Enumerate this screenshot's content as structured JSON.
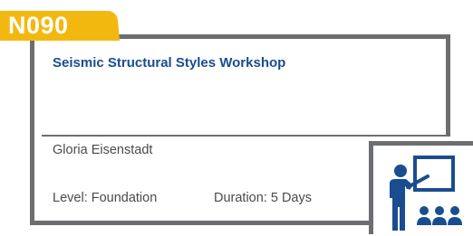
{
  "course": {
    "code": "N090",
    "title": "Seismic Structural Styles Workshop",
    "instructor": "Gloria Eisenstadt",
    "level": "Level: Foundation",
    "duration": "Duration: 5 Days"
  },
  "colors": {
    "accent": "#f3b80f",
    "frame": "#6d6e71",
    "title": "#1a4d8f",
    "icon": "#1a4d8f"
  },
  "icons": {
    "classroom": "presenter-classroom-icon"
  }
}
